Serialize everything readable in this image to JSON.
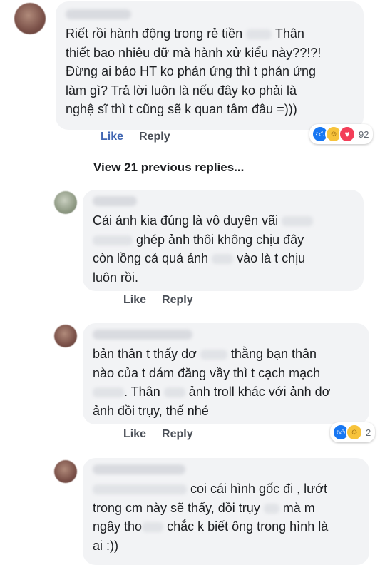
{
  "comments": [
    {
      "text_parts": [
        "Riết rồi hành động trong rẻ tiền ",
        " Thân\nthiết bao nhiêu dữ mà hành xử kiểu này??!?!\nĐừng ai bảo HT ko phản ứng thì t phản ứng\nlàm gì? Trả lời luôn là nếu đây ko phải là\nnghệ sĩ thì t cũng sẽ k quan tâm đâu =)))"
      ],
      "like_label": "Like",
      "reply_label": "Reply",
      "reaction_count": "92",
      "reactions": [
        "like-icon",
        "haha-icon",
        "love-icon"
      ]
    },
    {
      "text_parts": [
        "Cái ảnh kia đúng là vô duyên vãi ",
        "\n",
        " ghép ảnh thôi không chịu đây\ncòn lồng cả quả ảnh ",
        " vào là t chịu\nluôn rồi."
      ],
      "like_label": "Like",
      "reply_label": "Reply"
    },
    {
      "text_parts": [
        "bản thân t thấy dơ ",
        " thằng bạn thân\nnào của t dám đăng vầy thì t cạch mạch\n",
        ". Thân ",
        " ảnh troll khác với ảnh dơ\nảnh đồi trụy, thế nhé"
      ],
      "like_label": "Like",
      "reply_label": "Reply",
      "reaction_count": "2",
      "reactions": [
        "like-icon",
        "haha-icon"
      ]
    },
    {
      "text_parts": [
        "",
        " coi cái hình gốc đi , lướt\ntrong cm này sẽ thấy, đồi trụy ",
        " mà m\nngây tho",
        " chắc k biết ông trong hình là\nai :))"
      ]
    }
  ],
  "view_previous": "View 21 previous replies..."
}
